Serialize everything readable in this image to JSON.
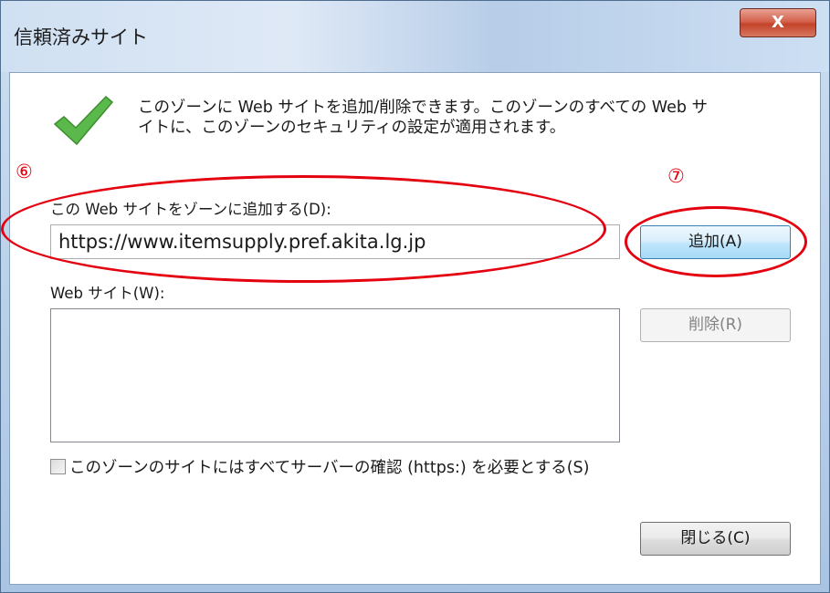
{
  "dialog": {
    "title": "信頼済みサイト",
    "close_glyph": "X"
  },
  "description": {
    "line1": "このゾーンに Web サイトを追加/削除できます。このゾーンのすべての Web サ",
    "line2": "イトに、このゾーンのセキュリティの設定が適用されます。"
  },
  "add_site": {
    "label": "この Web サイトをゾーンに追加する(D):",
    "value": "https://www.itemsupply.pref.akita.lg.jp",
    "button": "追加(A)"
  },
  "site_list": {
    "label": "Web サイト(W):",
    "items": [],
    "remove_button": "削除(R)"
  },
  "require_https": {
    "label": "このゾーンのサイトにはすべてサーバーの確認 (https:) を必要とする(S)",
    "checked": false
  },
  "close_button": "閉じる(C)",
  "annotations": {
    "marker_6": "⑥",
    "marker_7": "⑦",
    "color": "#e4000f"
  },
  "colors": {
    "check": "#4caf3c",
    "accent_button_border": "#3c7fb1"
  },
  "icons": {
    "check": "checkmark-icon",
    "close": "close-icon"
  }
}
